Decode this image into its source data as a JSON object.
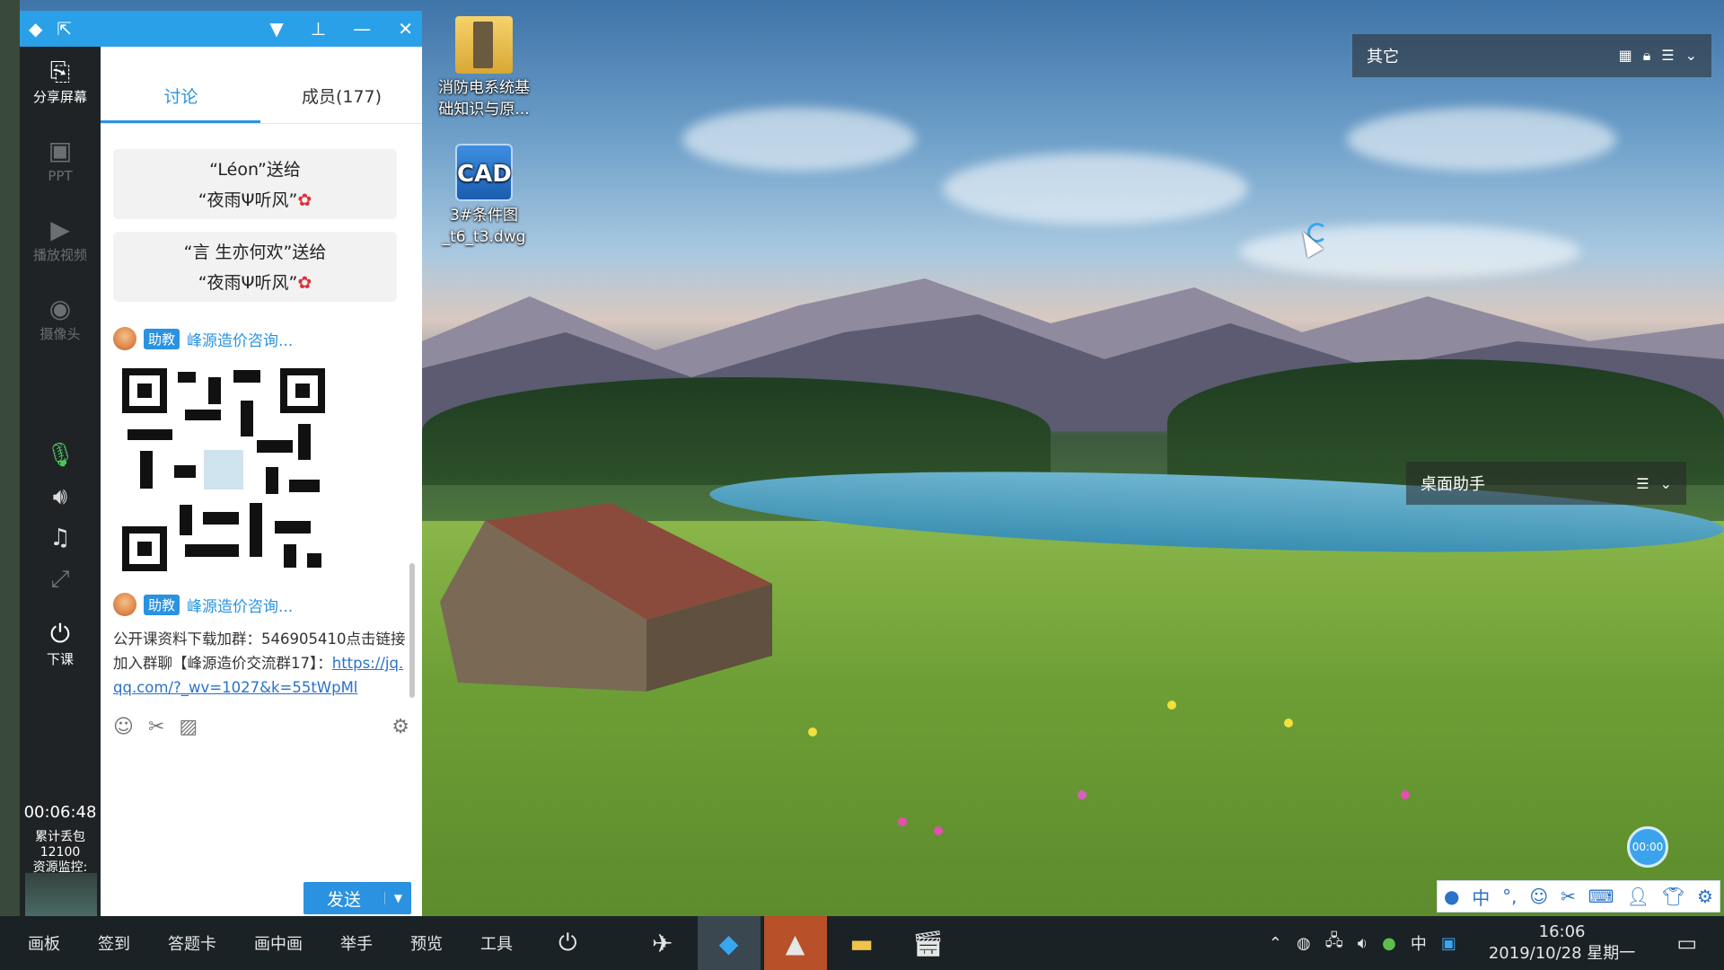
{
  "titlebar": {
    "icons": [
      "logo-icon",
      "share-out-icon"
    ],
    "controls": [
      "dropdown-icon",
      "pin-icon",
      "minimize-icon",
      "close-icon"
    ]
  },
  "toolbar": {
    "items": [
      {
        "label": "分享屏幕",
        "icon": "share-screen-icon"
      },
      {
        "label": "PPT",
        "icon": "ppt-icon"
      },
      {
        "label": "播放视频",
        "icon": "play-video-icon"
      },
      {
        "label": "摄像头",
        "icon": "camera-icon"
      }
    ],
    "end_class": "下课",
    "timer": "00:06:48",
    "stats": [
      "累计丢包",
      "12100",
      "资源监控:"
    ]
  },
  "chat": {
    "tabs": [
      {
        "label": "讨论"
      },
      {
        "label": "成员(177)"
      }
    ],
    "gifts": [
      {
        "line1": "“Léon”送给",
        "line2": "“夜雨Ψ听风”"
      },
      {
        "line1": "“言 生亦何欢”送给",
        "line2": "“夜雨Ψ听风”"
      }
    ],
    "messages": [
      {
        "badge": "助教",
        "sender": "峰源造价咨询..."
      },
      {
        "badge": "助教",
        "sender": "峰源造价咨询..."
      }
    ],
    "message_text": "公开课资料下载加群：546905410点击链接加入群聊【峰源造价交流群17】：",
    "message_link": "https://jq.qq.com/?_wv=1027&k=55tWpMl",
    "send_label": "发送"
  },
  "desktop": {
    "icons": [
      {
        "label": "消防电系统基础知识与原..."
      },
      {
        "label": "3#条件图_t6_t3.dwg",
        "glyph": "CAD"
      }
    ],
    "fence_top": "其它",
    "fence_mid": "桌面助手",
    "bubble": "00:00"
  },
  "taskbar": {
    "menu": [
      "画板",
      "签到",
      "答题卡",
      "画中画",
      "举手",
      "预览",
      "工具"
    ],
    "tray_ime": "中",
    "time": "16:06",
    "date": "2019/10/28 星期一"
  },
  "ime_bar": {
    "items": [
      "中"
    ]
  },
  "colors": {
    "accent": "#2a92e0",
    "titlebar": "#2aa0e8",
    "toolbar_bg": "#1f2326",
    "taskbar_bg": "#1a2226"
  }
}
